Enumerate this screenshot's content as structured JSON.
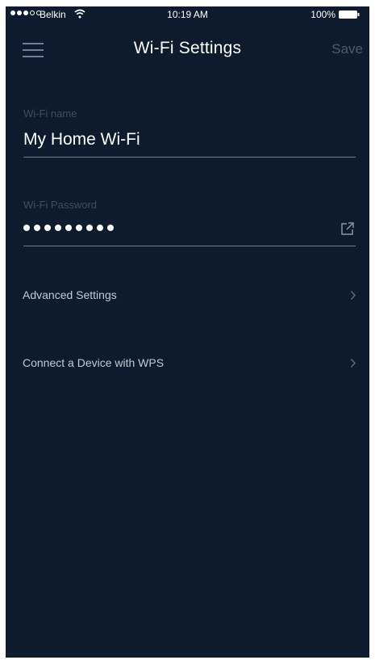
{
  "status_bar": {
    "carrier": "Belkin",
    "time": "10:19 AM",
    "battery": "100%"
  },
  "header": {
    "title": "Wi-Fi Settings",
    "save_label": "Save"
  },
  "fields": {
    "wifi_name": {
      "label": "Wi-Fi name",
      "value": "My Home Wi-Fi"
    },
    "wifi_password": {
      "label": "Wi-Fi Password",
      "masked_length": 9
    }
  },
  "rows": [
    {
      "label": "Advanced Settings"
    },
    {
      "label": "Connect a Device with WPS"
    }
  ],
  "icons": {
    "menu": "hamburger-menu-icon",
    "share": "share-external-icon",
    "chevron": "chevron-right-icon",
    "wifi": "wifi-icon",
    "battery": "battery-icon"
  },
  "colors": {
    "background": "#0e1a2d",
    "label": "#3f4d63",
    "save_disabled": "#4e5b70",
    "underline": "#6e7d93",
    "row_text": "#c3cad6"
  }
}
